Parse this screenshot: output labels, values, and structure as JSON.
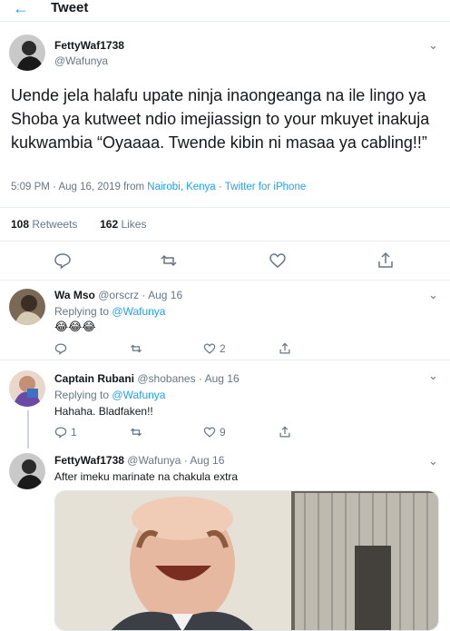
{
  "header": {
    "back_icon": "arrow-left-icon",
    "title": "Tweet"
  },
  "main_tweet": {
    "name": "FettyWaf1738",
    "handle": "@Wafunya",
    "text": "Uende jela halafu upate ninja inaongeanga na ile lingo ya Shoba ya kutweet ndio imejiassign to your mkuyet inakuja kukwambia “Oyaaaa. Twende kibin ni masaa ya cabling!!”",
    "time": "5:09 PM",
    "date": "Aug 16, 2019",
    "from_label": "from",
    "location": "Nairobi, Kenya",
    "client": "Twitter for iPhone",
    "retweets_count": "108",
    "retweets_label": "Retweets",
    "likes_count": "162",
    "likes_label": "Likes"
  },
  "replies": [
    {
      "name": "Wa Mso",
      "handle": "@orscrz",
      "date": "Aug 16",
      "replying_label": "Replying to",
      "replying_to": "@Wafunya",
      "text": "😂😂😂",
      "reply_count": "",
      "like_count": "2"
    },
    {
      "name": "Captain Rubani",
      "handle": "@shobanes",
      "date": "Aug 16",
      "replying_label": "Replying to",
      "replying_to": "@Wafunya",
      "text": "Hahaha. Bladfaken!!",
      "reply_count": "1",
      "like_count": "9"
    },
    {
      "name": "FettyWaf1738",
      "handle": "@Wafunya",
      "date": "Aug 16",
      "text": "After imeku marinate na chakula extra"
    }
  ],
  "separator": "·",
  "colors": {
    "accent": "#1da1f2",
    "muted": "#657786",
    "border": "#e6ecf0"
  }
}
